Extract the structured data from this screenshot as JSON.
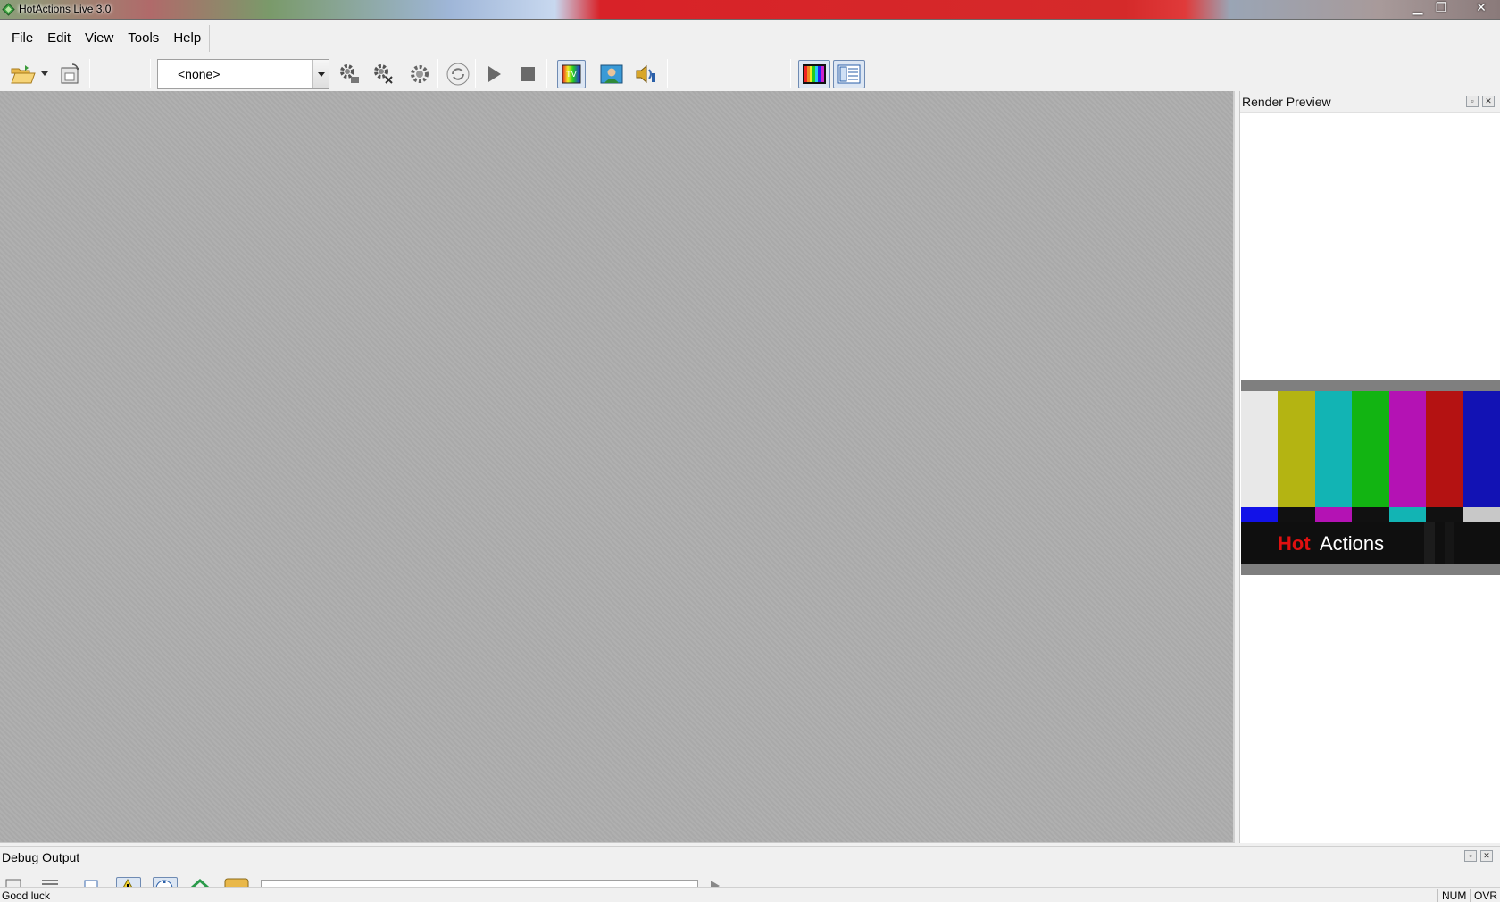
{
  "window": {
    "title": "HotActions Live 3.0",
    "controls": {
      "minimize": "▁",
      "maximize": "❐",
      "close": "✕"
    }
  },
  "menu": {
    "items": [
      "File",
      "Edit",
      "View",
      "Tools",
      "Help"
    ]
  },
  "toolbar": {
    "icons": [
      "open-folder-icon",
      "dropdown-arrow-icon",
      "save-document-icon",
      "gears-add-icon",
      "gears-remove-icon",
      "gear-settings-icon",
      "refresh-icon",
      "play-icon",
      "stop-icon",
      "tv-output-icon",
      "person-photo-icon",
      "audio-speaker-icon",
      "color-bars-icon",
      "layout-grid-icon"
    ],
    "combo": {
      "value": "<none>"
    },
    "pressed": [
      "tv-output",
      "color-bars",
      "layout-grid"
    ]
  },
  "render_preview": {
    "title": "Render Preview",
    "image": {
      "logo_hot": "Hot",
      "logo_actions": "Actions",
      "bar_colors": [
        "#e8e8e8",
        "#b4b412",
        "#12b4b4",
        "#12b412",
        "#b412b4",
        "#b41212",
        "#1212b4"
      ],
      "strip_colors": [
        "#1212e8",
        "#111111",
        "#b412b4",
        "#111111",
        "#12b4b4",
        "#111111",
        "#c8c8c8"
      ]
    }
  },
  "debug_output": {
    "title": "Debug Output"
  },
  "statusbar": {
    "message": "Good luck",
    "num": "NUM",
    "ovr": "OVR"
  },
  "colors": {
    "workspace": "#adadad",
    "chrome": "#f0f0f0",
    "pressed_bg": "#dce6f3",
    "pressed_border": "#6f8bb3"
  }
}
